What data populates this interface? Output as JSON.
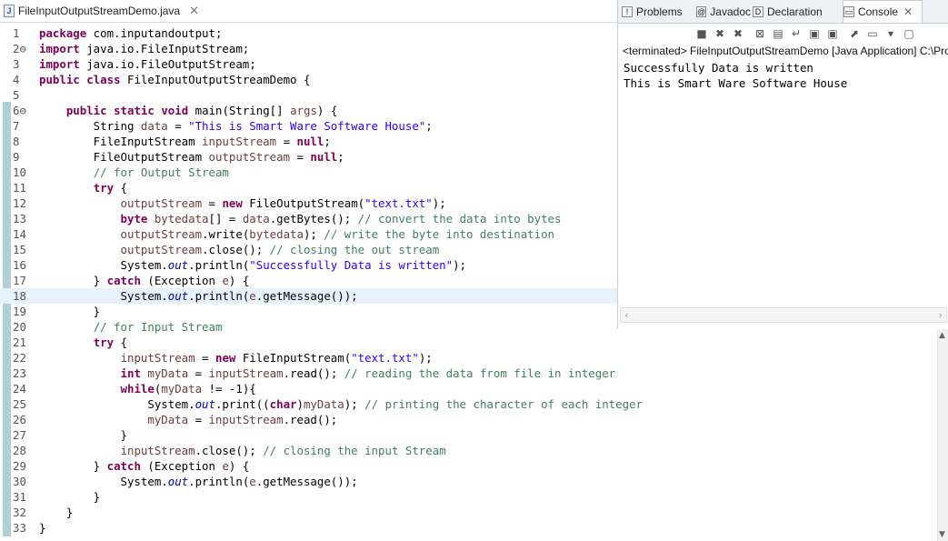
{
  "editor": {
    "tab_title": "FileInputOutputStreamDemo.java",
    "tab_close": "✕",
    "file_icon": "J",
    "highlighted_line": 18,
    "lines": [
      {
        "n": "1",
        "tokens": [
          {
            "c": "kw",
            "t": "package"
          },
          {
            "c": "",
            "t": " com.inputandoutput;"
          }
        ]
      },
      {
        "n": "2⊖",
        "tokens": [
          {
            "c": "kw",
            "t": "import"
          },
          {
            "c": "",
            "t": " java.io.FileInputStream;"
          }
        ]
      },
      {
        "n": "3",
        "tokens": [
          {
            "c": "kw",
            "t": "import"
          },
          {
            "c": "",
            "t": " java.io.FileOutputStream;"
          }
        ]
      },
      {
        "n": "4",
        "tokens": [
          {
            "c": "kw",
            "t": "public"
          },
          {
            "c": "",
            "t": " "
          },
          {
            "c": "kw",
            "t": "class"
          },
          {
            "c": "",
            "t": " FileInputOutputStreamDemo {"
          }
        ]
      },
      {
        "n": "5",
        "tokens": []
      },
      {
        "n": "6⊖",
        "tokens": [
          {
            "c": "",
            "t": "    "
          },
          {
            "c": "kw",
            "t": "public"
          },
          {
            "c": "",
            "t": " "
          },
          {
            "c": "kw",
            "t": "static"
          },
          {
            "c": "",
            "t": " "
          },
          {
            "c": "kw",
            "t": "void"
          },
          {
            "c": "",
            "t": " main(String[] "
          },
          {
            "c": "var",
            "t": "args"
          },
          {
            "c": "",
            "t": ") {"
          }
        ]
      },
      {
        "n": "7",
        "tokens": [
          {
            "c": "",
            "t": "        String "
          },
          {
            "c": "var",
            "t": "data"
          },
          {
            "c": "",
            "t": " = "
          },
          {
            "c": "str",
            "t": "\"This is Smart Ware Software House\""
          },
          {
            "c": "",
            "t": ";"
          }
        ]
      },
      {
        "n": "8",
        "tokens": [
          {
            "c": "",
            "t": "        FileInputStream "
          },
          {
            "c": "var",
            "t": "inputStream"
          },
          {
            "c": "",
            "t": " = "
          },
          {
            "c": "kw",
            "t": "null"
          },
          {
            "c": "",
            "t": ";"
          }
        ]
      },
      {
        "n": "9",
        "tokens": [
          {
            "c": "",
            "t": "        FileOutputStream "
          },
          {
            "c": "var",
            "t": "outputStream"
          },
          {
            "c": "",
            "t": " = "
          },
          {
            "c": "kw",
            "t": "null"
          },
          {
            "c": "",
            "t": ";"
          }
        ]
      },
      {
        "n": "10",
        "tokens": [
          {
            "c": "",
            "t": "        "
          },
          {
            "c": "cm",
            "t": "// for Output Stream"
          }
        ]
      },
      {
        "n": "11",
        "tokens": [
          {
            "c": "",
            "t": "        "
          },
          {
            "c": "kw",
            "t": "try"
          },
          {
            "c": "",
            "t": " {"
          }
        ]
      },
      {
        "n": "12",
        "tokens": [
          {
            "c": "",
            "t": "            "
          },
          {
            "c": "var",
            "t": "outputStream"
          },
          {
            "c": "",
            "t": " = "
          },
          {
            "c": "kw",
            "t": "new"
          },
          {
            "c": "",
            "t": " FileOutputStream("
          },
          {
            "c": "str",
            "t": "\"text.txt\""
          },
          {
            "c": "",
            "t": ");"
          }
        ]
      },
      {
        "n": "13",
        "tokens": [
          {
            "c": "",
            "t": "            "
          },
          {
            "c": "kw",
            "t": "byte"
          },
          {
            "c": "",
            "t": " "
          },
          {
            "c": "var",
            "t": "bytedata"
          },
          {
            "c": "",
            "t": "[] = "
          },
          {
            "c": "var",
            "t": "data"
          },
          {
            "c": "",
            "t": ".getBytes(); "
          },
          {
            "c": "cm",
            "t": "// convert the data into bytes"
          }
        ]
      },
      {
        "n": "14",
        "tokens": [
          {
            "c": "",
            "t": "            "
          },
          {
            "c": "var",
            "t": "outputStream"
          },
          {
            "c": "",
            "t": ".write("
          },
          {
            "c": "var",
            "t": "bytedata"
          },
          {
            "c": "",
            "t": "); "
          },
          {
            "c": "cm",
            "t": "// write the byte into destination"
          }
        ]
      },
      {
        "n": "15",
        "tokens": [
          {
            "c": "",
            "t": "            "
          },
          {
            "c": "var",
            "t": "outputStream"
          },
          {
            "c": "",
            "t": ".close(); "
          },
          {
            "c": "cm",
            "t": "// closing the out stream"
          }
        ]
      },
      {
        "n": "16",
        "tokens": [
          {
            "c": "",
            "t": "            System."
          },
          {
            "c": "fld",
            "t": "out"
          },
          {
            "c": "",
            "t": ".println("
          },
          {
            "c": "str",
            "t": "\"Successfully Data is written\""
          },
          {
            "c": "",
            "t": ");"
          }
        ]
      },
      {
        "n": "17",
        "tokens": [
          {
            "c": "",
            "t": "        } "
          },
          {
            "c": "kw",
            "t": "catch"
          },
          {
            "c": "",
            "t": " (Exception "
          },
          {
            "c": "var",
            "t": "e"
          },
          {
            "c": "",
            "t": ") {"
          }
        ]
      },
      {
        "n": "18",
        "tokens": [
          {
            "c": "",
            "t": "            System."
          },
          {
            "c": "fld",
            "t": "out"
          },
          {
            "c": "",
            "t": ".println("
          },
          {
            "c": "var",
            "t": "e"
          },
          {
            "c": "",
            "t": ".getMessage());"
          }
        ]
      },
      {
        "n": "19",
        "tokens": [
          {
            "c": "",
            "t": "        }"
          }
        ]
      },
      {
        "n": "20",
        "tokens": [
          {
            "c": "",
            "t": "        "
          },
          {
            "c": "cm",
            "t": "// for Input Stream"
          }
        ]
      },
      {
        "n": "21",
        "tokens": [
          {
            "c": "",
            "t": "        "
          },
          {
            "c": "kw",
            "t": "try"
          },
          {
            "c": "",
            "t": " {"
          }
        ]
      },
      {
        "n": "22",
        "tokens": [
          {
            "c": "",
            "t": "            "
          },
          {
            "c": "var",
            "t": "inputStream"
          },
          {
            "c": "",
            "t": " = "
          },
          {
            "c": "kw",
            "t": "new"
          },
          {
            "c": "",
            "t": " FileInputStream("
          },
          {
            "c": "str",
            "t": "\"text.txt\""
          },
          {
            "c": "",
            "t": ");"
          }
        ]
      },
      {
        "n": "23",
        "tokens": [
          {
            "c": "",
            "t": "            "
          },
          {
            "c": "kw",
            "t": "int"
          },
          {
            "c": "",
            "t": " "
          },
          {
            "c": "var",
            "t": "myData"
          },
          {
            "c": "",
            "t": " = "
          },
          {
            "c": "var",
            "t": "inputStream"
          },
          {
            "c": "",
            "t": ".read(); "
          },
          {
            "c": "cm",
            "t": "// reading the data from file in integer"
          }
        ]
      },
      {
        "n": "24",
        "tokens": [
          {
            "c": "",
            "t": "            "
          },
          {
            "c": "kw",
            "t": "while"
          },
          {
            "c": "",
            "t": "("
          },
          {
            "c": "var",
            "t": "myData"
          },
          {
            "c": "",
            "t": " != -1){"
          }
        ]
      },
      {
        "n": "25",
        "tokens": [
          {
            "c": "",
            "t": "                System."
          },
          {
            "c": "fld",
            "t": "out"
          },
          {
            "c": "",
            "t": ".print(("
          },
          {
            "c": "kw",
            "t": "char"
          },
          {
            "c": "",
            "t": ")"
          },
          {
            "c": "var",
            "t": "myData"
          },
          {
            "c": "",
            "t": "); "
          },
          {
            "c": "cm",
            "t": "// printing the character of each integer"
          }
        ]
      },
      {
        "n": "26",
        "tokens": [
          {
            "c": "",
            "t": "                "
          },
          {
            "c": "var",
            "t": "myData"
          },
          {
            "c": "",
            "t": " = "
          },
          {
            "c": "var",
            "t": "inputStream"
          },
          {
            "c": "",
            "t": ".read();"
          }
        ]
      },
      {
        "n": "27",
        "tokens": [
          {
            "c": "",
            "t": "            }"
          }
        ]
      },
      {
        "n": "28",
        "tokens": [
          {
            "c": "",
            "t": "            "
          },
          {
            "c": "var",
            "t": "inputStream"
          },
          {
            "c": "",
            "t": ".close(); "
          },
          {
            "c": "cm",
            "t": "// closing the input Stream"
          }
        ]
      },
      {
        "n": "29",
        "tokens": [
          {
            "c": "",
            "t": "        } "
          },
          {
            "c": "kw",
            "t": "catch"
          },
          {
            "c": "",
            "t": " (Exception "
          },
          {
            "c": "var",
            "t": "e"
          },
          {
            "c": "",
            "t": ") {"
          }
        ]
      },
      {
        "n": "30",
        "tokens": [
          {
            "c": "",
            "t": "            System."
          },
          {
            "c": "fld",
            "t": "out"
          },
          {
            "c": "",
            "t": ".println("
          },
          {
            "c": "var",
            "t": "e"
          },
          {
            "c": "",
            "t": ".getMessage());"
          }
        ]
      },
      {
        "n": "31",
        "tokens": [
          {
            "c": "",
            "t": "        }"
          }
        ]
      },
      {
        "n": "32",
        "tokens": [
          {
            "c": "",
            "t": "    }"
          }
        ]
      },
      {
        "n": "33",
        "tokens": [
          {
            "c": "",
            "t": "}"
          }
        ]
      }
    ]
  },
  "console_panel": {
    "tabs": [
      {
        "label": "Problems",
        "icon": "problems-icon",
        "glyph": "!"
      },
      {
        "label": "Javadoc",
        "icon": "javadoc-icon",
        "glyph": "@"
      },
      {
        "label": "Declaration",
        "icon": "declaration-icon",
        "glyph": "D"
      },
      {
        "label": "Console",
        "icon": "console-icon",
        "glyph": "▭",
        "active": true
      }
    ],
    "close_glyph": "✕",
    "toolbar": [
      {
        "name": "terminate-icon",
        "glyph": "■"
      },
      {
        "name": "remove-launch-icon",
        "glyph": "✖"
      },
      {
        "name": "remove-all-terminated-icon",
        "glyph": "✖"
      },
      {
        "name": "clear-console-icon",
        "glyph": "⊠"
      },
      {
        "name": "scroll-lock-icon",
        "glyph": "▤"
      },
      {
        "name": "word-wrap-icon",
        "glyph": "↵"
      },
      {
        "name": "show-console-on-output-icon",
        "glyph": "▣"
      },
      {
        "name": "show-console-on-error-icon",
        "glyph": "▣"
      },
      {
        "name": "pin-console-icon",
        "glyph": "⬈"
      },
      {
        "name": "display-selected-console-icon",
        "glyph": "▭"
      },
      {
        "name": "dropdown-icon",
        "glyph": "▾"
      },
      {
        "name": "new-console-icon",
        "glyph": "▢"
      }
    ],
    "terminated_label": "<terminated> FileInputOutputStreamDemo [Java Application] C:\\Pro",
    "output_lines": [
      "Successfully Data is written",
      "This is Smart Ware Software House"
    ],
    "scroll_left": "‹",
    "scroll_right": "›"
  },
  "scrollbar": {
    "up": "▲",
    "down": "▼"
  }
}
